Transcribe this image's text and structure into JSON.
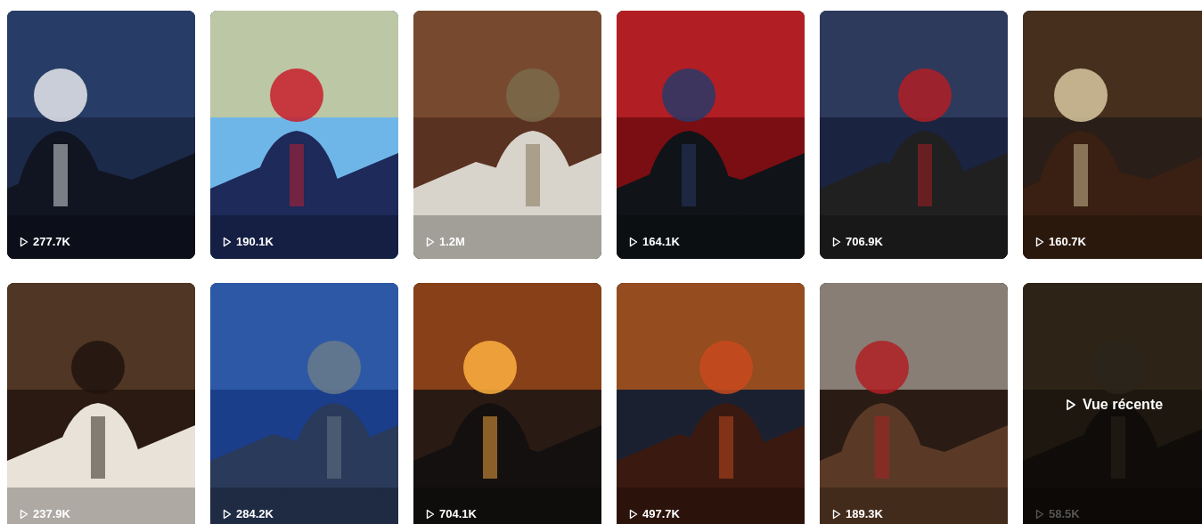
{
  "videos": [
    {
      "kind": "picture",
      "views": "277.7K",
      "recently_viewed": false
    },
    {
      "kind": "picture",
      "views": "190.1K",
      "recently_viewed": false
    },
    {
      "kind": "picture",
      "views": "1.2M",
      "recently_viewed": false
    },
    {
      "kind": "picture",
      "views": "164.1K",
      "recently_viewed": false
    },
    {
      "kind": "picture",
      "views": "706.9K",
      "recently_viewed": false
    },
    {
      "kind": "picture",
      "views": "160.7K",
      "recently_viewed": false
    },
    {
      "kind": "picture",
      "views": "237.9K",
      "recently_viewed": false
    },
    {
      "kind": "picture",
      "views": "284.2K",
      "recently_viewed": false
    },
    {
      "kind": "picture",
      "views": "704.1K",
      "recently_viewed": false
    },
    {
      "kind": "picture",
      "views": "497.7K",
      "recently_viewed": false
    },
    {
      "kind": "picture",
      "views": "189.3K",
      "recently_viewed": false
    },
    {
      "kind": "picture",
      "views": "58.5K",
      "recently_viewed": true,
      "overlay_label": "Vue récente"
    }
  ]
}
